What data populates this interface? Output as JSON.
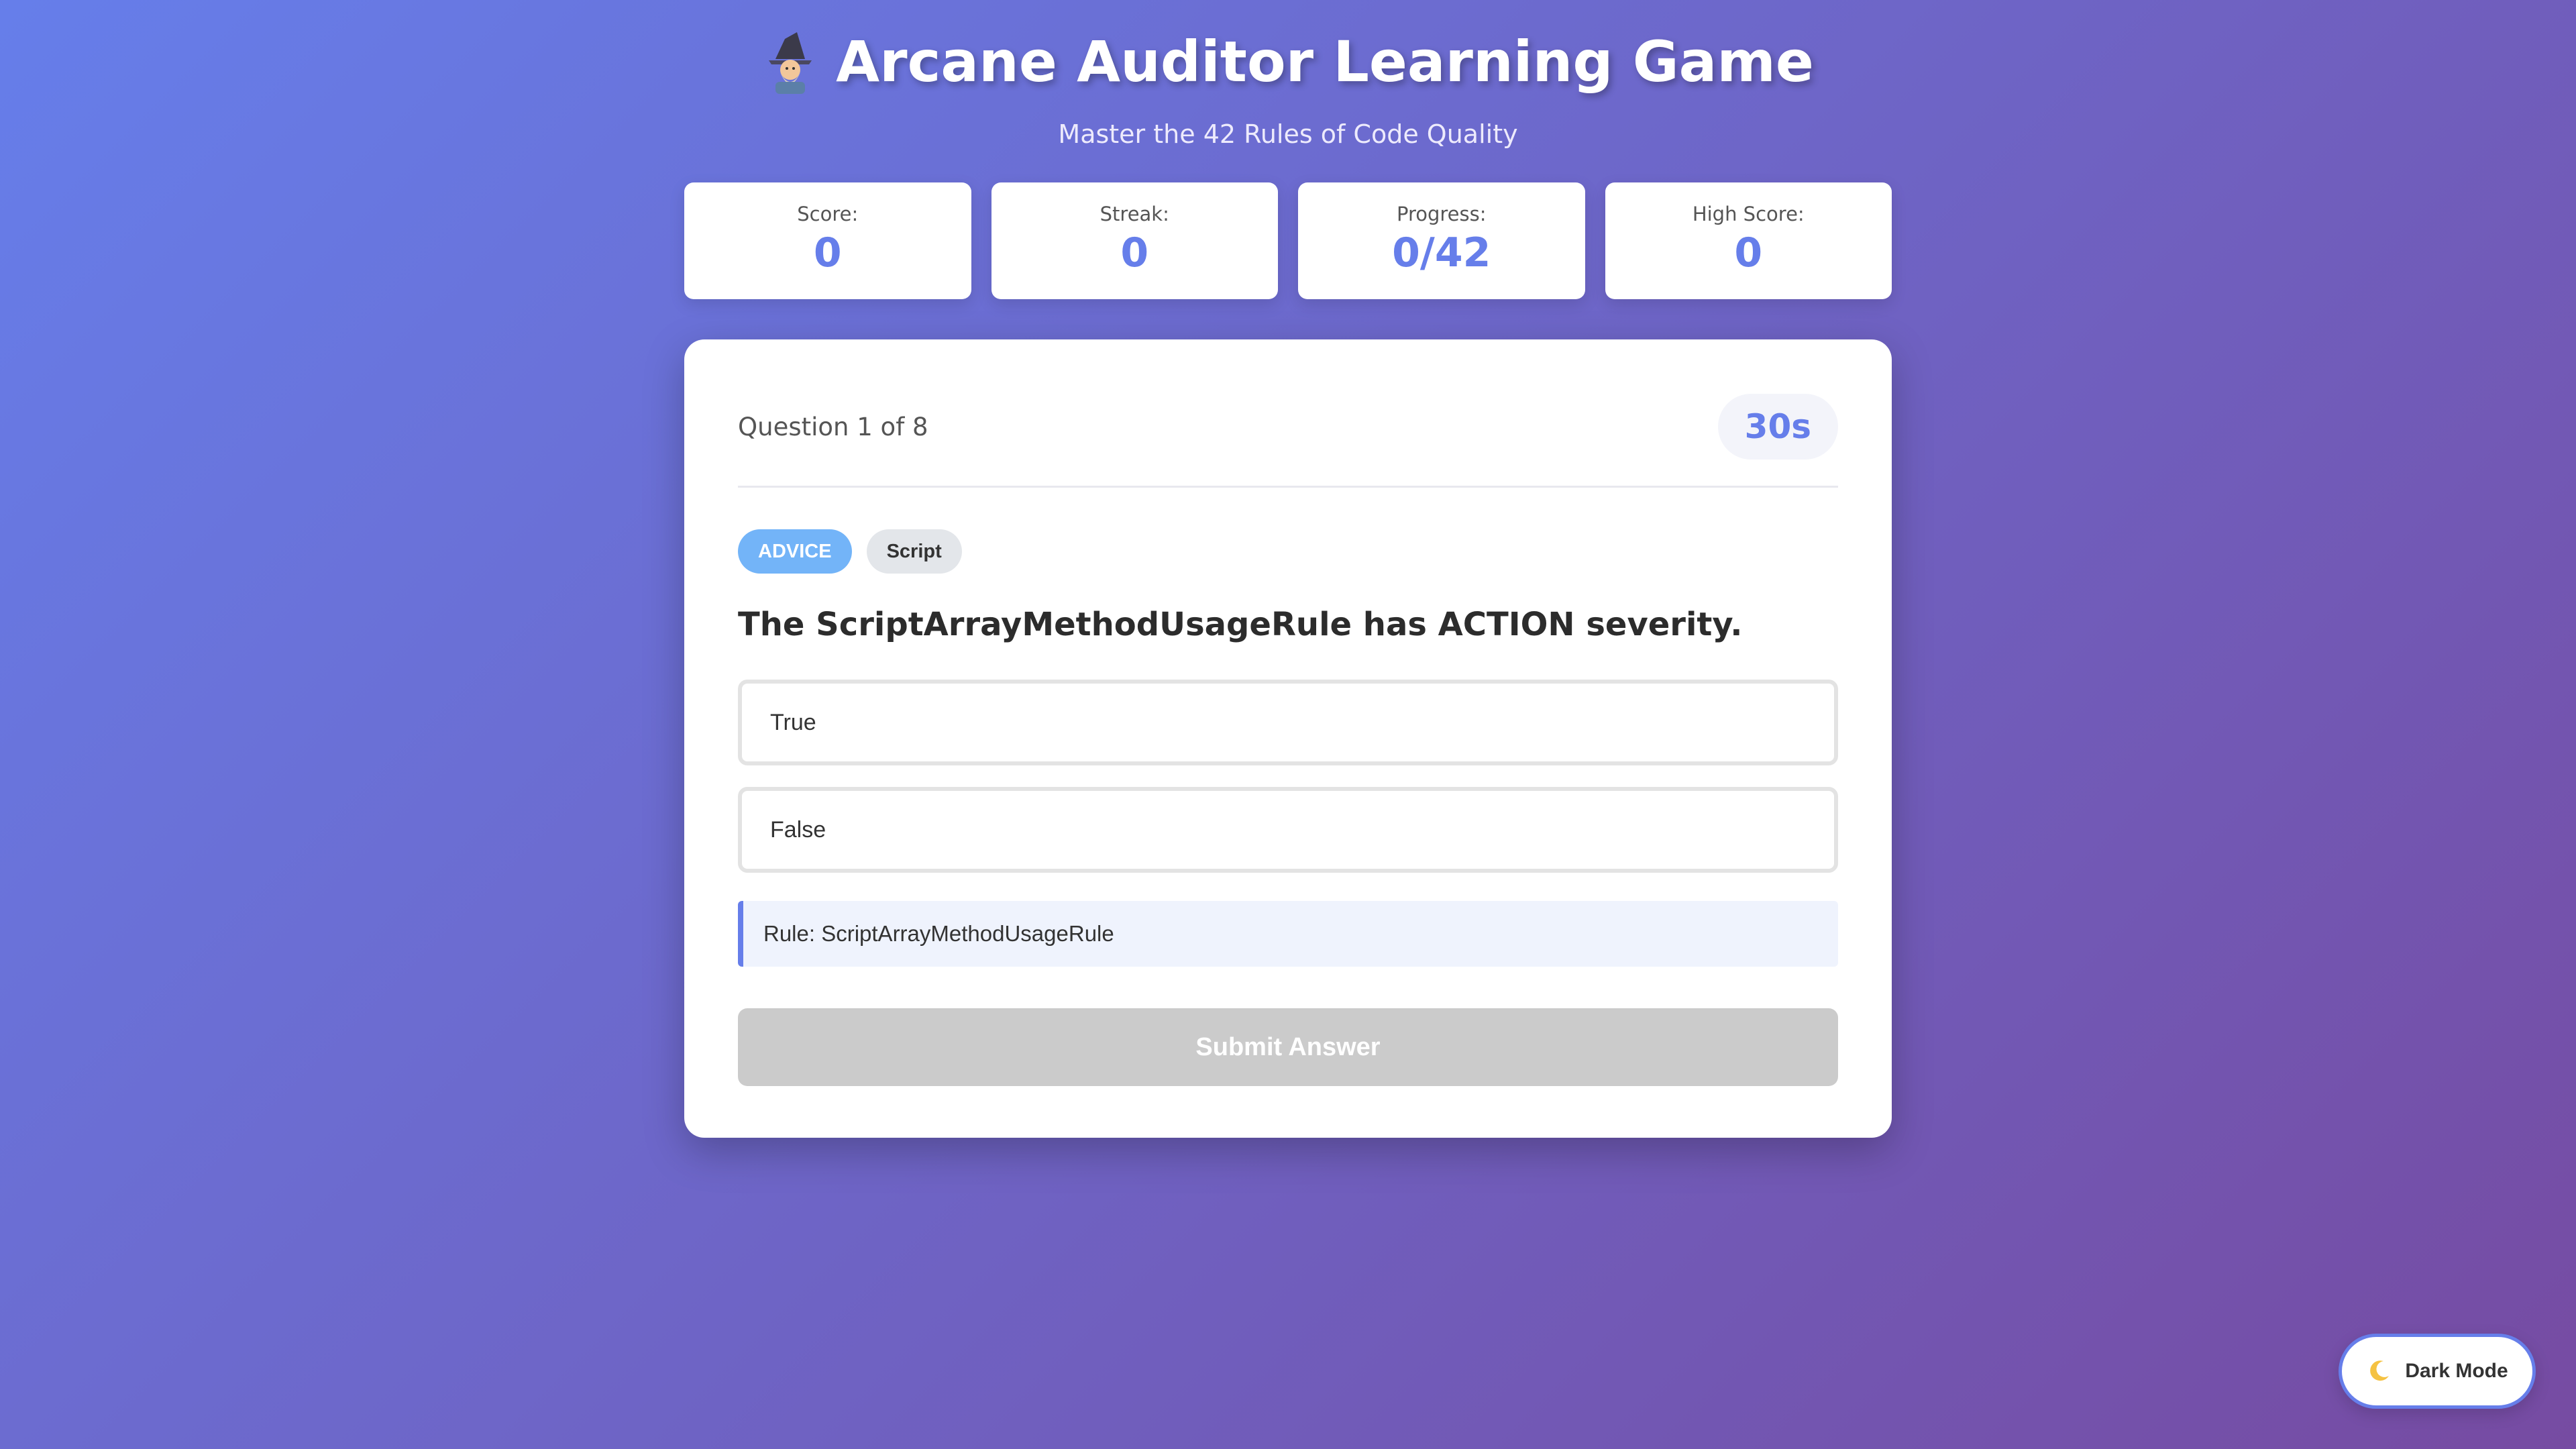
{
  "header": {
    "title": "Arcane Auditor Learning Game",
    "title_icon": "wizard-icon",
    "subtitle": "Master the 42 Rules of Code Quality"
  },
  "stats": [
    {
      "label": "Score:",
      "value": "0"
    },
    {
      "label": "Streak:",
      "value": "0"
    },
    {
      "label": "Progress:",
      "value": "0/42"
    },
    {
      "label": "High Score:",
      "value": "0"
    }
  ],
  "quiz": {
    "counter": "Question 1 of 8",
    "timer": "30s",
    "tags": [
      {
        "label": "ADVICE",
        "color": "#73b4f8"
      },
      {
        "label": "Script",
        "color": "#e3e6ea"
      }
    ],
    "question": "The ScriptArrayMethodUsageRule has ACTION severity.",
    "options": [
      "True",
      "False"
    ],
    "hint": "Rule: ScriptArrayMethodUsageRule",
    "submit_label": "Submit Answer"
  },
  "theme_toggle": {
    "label": "Dark Mode",
    "icon": "moon-icon"
  },
  "colors": {
    "accent": "#667eea",
    "gradient_end": "#764ba2"
  }
}
